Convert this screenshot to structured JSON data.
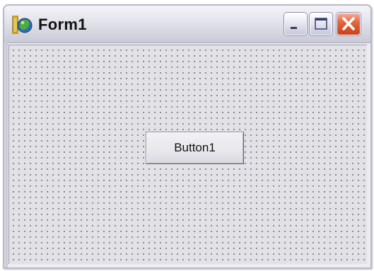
{
  "window": {
    "title": "Form1",
    "icon": "delphi-form-icon",
    "controls": {
      "minimize_icon": "minimize-icon",
      "maximize_icon": "maximize-icon",
      "close_icon": "close-icon"
    }
  },
  "form": {
    "grid": "dotted",
    "button": {
      "label": "Button1"
    }
  },
  "colors": {
    "close_button": "#d9532a",
    "client_background": "#e1e1e6",
    "title_text": "#111111"
  }
}
